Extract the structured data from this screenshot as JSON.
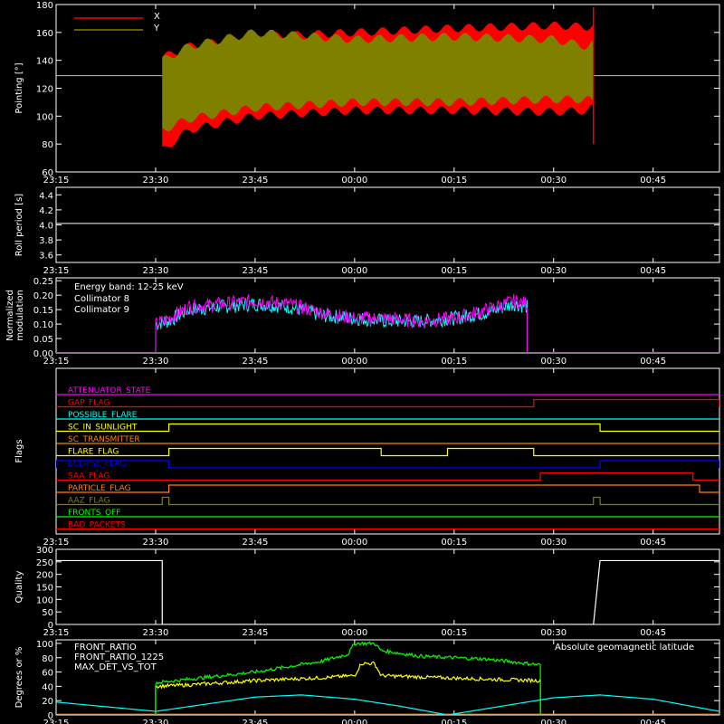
{
  "chart_data": [
    {
      "type": "line",
      "id": "pointing",
      "ylabel": "Pointing [°]",
      "ylim": [
        60,
        180
      ],
      "yticks": [
        60,
        80,
        100,
        120,
        140,
        160,
        180
      ],
      "xlim": [
        "23:15",
        "00:55"
      ],
      "xticks": [
        "23:15",
        "23:30",
        "23:45",
        "00:00",
        "00:15",
        "00:30",
        "00:45"
      ],
      "reference_line": 129,
      "legend_placement": "top-left",
      "series": [
        {
          "name": "X",
          "color": "#ff0000",
          "band_x": [
            "23:31",
            "23:35",
            "23:45",
            "00:00",
            "00:15",
            "00:30",
            "00:35",
            "00:36"
          ],
          "upper": [
            142,
            150,
            157,
            160,
            163,
            165,
            164,
            165
          ],
          "lower": [
            75,
            90,
            100,
            104,
            104,
            103,
            104,
            106
          ]
        },
        {
          "name": "Y",
          "color": "#808000",
          "band_x": [
            "23:31",
            "23:35",
            "23:45",
            "00:00",
            "00:15",
            "00:30",
            "00:35",
            "00:36"
          ],
          "upper": [
            140,
            150,
            160,
            155,
            157,
            155,
            150,
            152
          ],
          "lower": [
            90,
            98,
            106,
            110,
            110,
            112,
            112,
            110
          ]
        }
      ]
    },
    {
      "type": "line",
      "id": "roll-period",
      "ylabel": "Roll period [s]",
      "ylim": [
        3.5,
        4.5
      ],
      "yticks": [
        3.6,
        3.8,
        4.0,
        4.2,
        4.4
      ],
      "xticks": [
        "23:15",
        "23:30",
        "23:45",
        "00:00",
        "00:15",
        "00:30",
        "00:45"
      ],
      "series": [
        {
          "name": "",
          "color": "#ffffff",
          "x": [
            "23:15",
            "00:55"
          ],
          "y": [
            4.02,
            4.02
          ]
        }
      ]
    },
    {
      "type": "line",
      "id": "modulation",
      "ylabel": "Normalized\nmodulation",
      "ylim": [
        0,
        0.26
      ],
      "yticks": [
        0.0,
        0.05,
        0.1,
        0.15,
        0.2,
        0.25
      ],
      "xticks": [
        "23:15",
        "23:30",
        "23:45",
        "00:00",
        "00:15",
        "00:30",
        "00:45"
      ],
      "annotation": "Energy band: 12-25 keV",
      "legend_placement": "top-left",
      "series": [
        {
          "name": "Collimator 8",
          "color": "#00ffff",
          "x": [
            "23:30",
            "23:32",
            "23:35",
            "23:40",
            "23:45",
            "23:50",
            "23:55",
            "00:00",
            "00:05",
            "00:10",
            "00:15",
            "00:20",
            "00:24",
            "00:26"
          ],
          "y": [
            0.1,
            0.11,
            0.15,
            0.16,
            0.17,
            0.16,
            0.13,
            0.12,
            0.11,
            0.11,
            0.12,
            0.14,
            0.17,
            0.16
          ]
        },
        {
          "name": "Collimator 9",
          "color": "#ff00ff",
          "x": [
            "23:30",
            "23:32",
            "23:35",
            "23:40",
            "23:45",
            "23:50",
            "23:55",
            "00:00",
            "00:05",
            "00:10",
            "00:15",
            "00:20",
            "00:24",
            "00:26"
          ],
          "y": [
            0.1,
            0.12,
            0.16,
            0.17,
            0.18,
            0.17,
            0.14,
            0.12,
            0.12,
            0.11,
            0.12,
            0.15,
            0.18,
            0.17
          ]
        }
      ]
    },
    {
      "type": "table",
      "id": "flags",
      "ylabel": "Flags",
      "xticks": [
        "23:15",
        "23:30",
        "23:45",
        "00:00",
        "00:15",
        "00:30",
        "00:45"
      ],
      "series": [
        {
          "name": "ATTENUATOR_STATE",
          "color": "#ff00ff",
          "segments": []
        },
        {
          "name": "GAP_FLAG",
          "color": "#ff0000",
          "segments": [
            [
              "00:27",
              "00:55"
            ]
          ]
        },
        {
          "name": "POSSIBLE_FLARE",
          "color": "#00ffff",
          "segments": []
        },
        {
          "name": "SC_IN_SUNLIGHT",
          "color": "#ffff00",
          "segments": [
            [
              "23:32",
              "00:37"
            ]
          ]
        },
        {
          "name": "SC_TRANSMITTER",
          "color": "#ff8000",
          "segments": []
        },
        {
          "name": "FLARE_FLAG",
          "color": "#ffff00",
          "segments": [
            [
              "23:32",
              "00:04"
            ],
            [
              "00:14",
              "00:27"
            ]
          ]
        },
        {
          "name": "ECLIPSE_FLAG",
          "color": "#0000ff",
          "segments": [
            [
              "23:15",
              "23:32"
            ],
            [
              "00:37",
              "00:55"
            ]
          ]
        },
        {
          "name": "SAA_FLAG",
          "color": "#ff0000",
          "segments": [
            [
              "00:28",
              "00:51"
            ]
          ]
        },
        {
          "name": "PARTICLE_FLAG",
          "color": "#ff8000",
          "segments": [
            [
              "23:32",
              "00:52"
            ]
          ]
        },
        {
          "name": "AAZ_FLAG",
          "color": "#808000",
          "segments": [
            [
              "23:31",
              "23:32"
            ],
            [
              "00:36",
              "00:37"
            ]
          ]
        },
        {
          "name": "FRONTS_OFF",
          "color": "#00ff00",
          "segments": []
        },
        {
          "name": "BAD_PACKETS",
          "color": "#ff0000",
          "segments": []
        }
      ]
    },
    {
      "type": "line",
      "id": "quality",
      "ylabel": "Quality",
      "ylim": [
        0,
        300
      ],
      "yticks": [
        0,
        50,
        100,
        150,
        200,
        250,
        300
      ],
      "xticks": [
        "23:15",
        "23:30",
        "23:45",
        "00:00",
        "00:15",
        "00:30",
        "00:45"
      ],
      "series": [
        {
          "name": "",
          "color": "#ffffff",
          "x": [
            "23:15",
            "23:31",
            "23:31",
            "00:36",
            "00:37",
            "00:55"
          ],
          "y": [
            255,
            255,
            0,
            0,
            255,
            255
          ]
        }
      ]
    },
    {
      "type": "line",
      "id": "ratios",
      "ylabel": "Degrees or %",
      "ylim": [
        0,
        105
      ],
      "yticks": [
        0,
        20,
        40,
        60,
        80,
        100
      ],
      "xticks": [
        "23:15",
        "23:30",
        "23:45",
        "00:00",
        "00:15",
        "00:30",
        "00:45"
      ],
      "legend_placement": "top-left",
      "series": [
        {
          "name": "FRONT_RATIO",
          "color": "#ffff00",
          "x": [
            "23:30",
            "23:35",
            "23:45",
            "23:55",
            "00:00",
            "00:01",
            "00:03",
            "00:04",
            "00:10",
            "00:20",
            "00:28"
          ],
          "y": [
            40,
            42,
            48,
            52,
            55,
            72,
            72,
            55,
            53,
            50,
            48
          ]
        },
        {
          "name": "FRONT_RATIO_1225",
          "color": "#00ff00",
          "x": [
            "23:30",
            "23:35",
            "23:45",
            "23:55",
            "23:59",
            "00:00",
            "00:03",
            "00:04",
            "00:10",
            "00:20",
            "00:28"
          ],
          "y": [
            45,
            50,
            60,
            75,
            85,
            100,
            100,
            90,
            82,
            78,
            70
          ]
        },
        {
          "name": "MAX_DET_VS_TOT",
          "color": "#ff8000",
          "x": [
            "23:15",
            "00:55"
          ],
          "y": [
            1,
            1
          ]
        },
        {
          "name": "Absolute geomagnetic latitude",
          "color": "#00ffff",
          "x": [
            "23:15",
            "23:30",
            "23:45",
            "23:52",
            "00:00",
            "00:07",
            "00:14",
            "00:30",
            "00:37",
            "00:45",
            "00:55"
          ],
          "y": [
            18,
            5,
            25,
            28,
            22,
            12,
            0,
            24,
            28,
            22,
            5
          ]
        }
      ]
    }
  ]
}
